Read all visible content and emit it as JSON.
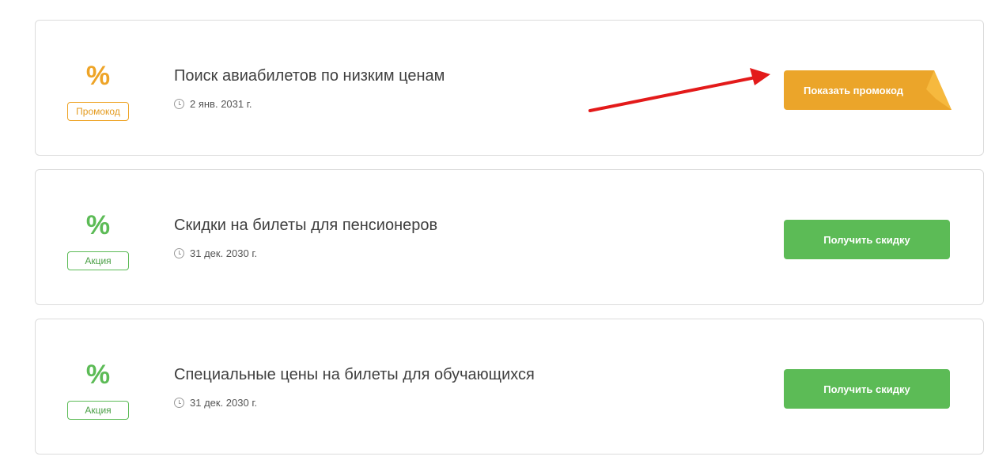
{
  "cards": [
    {
      "icon": "%",
      "badge": "Промокод",
      "title": "Поиск авиабилетов по низким ценам",
      "date": "2 янв. 2031 г.",
      "button": "Показать промокод",
      "accent": "#eea427"
    },
    {
      "icon": "%",
      "badge": "Акция",
      "title": "Скидки на билеты для пенсионеров",
      "date": "31 дек. 2030 г.",
      "button": "Получить скидку",
      "accent": "#5cbb56"
    },
    {
      "icon": "%",
      "badge": "Акция",
      "title": "Специальные цены на билеты для обучающихся",
      "date": "31 дек. 2030 г.",
      "button": "Получить скидку",
      "accent": "#5cbb56"
    }
  ],
  "annotation": {
    "arrow_color": "#e31a1a"
  }
}
